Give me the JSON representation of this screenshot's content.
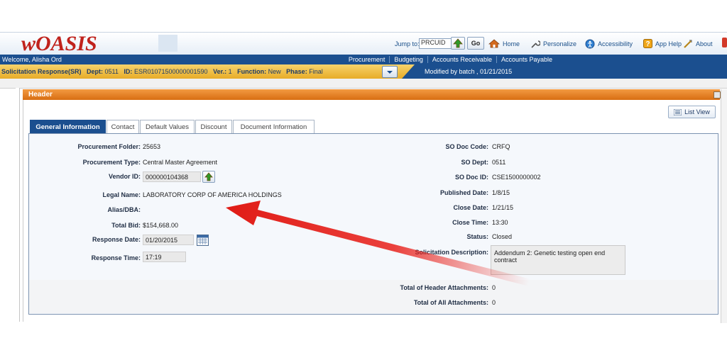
{
  "app": {
    "logo_text": "wOASIS",
    "jump_to_label": "Jump to:",
    "jump_to_value": "PRCUID",
    "go_label": "Go",
    "nav_links": [
      "Home",
      "Personalize",
      "Accessibility",
      "App Help",
      "About"
    ]
  },
  "menubar": {
    "welcome": "Welcome, Alisha Ord",
    "items": [
      "Procurement",
      "Budgeting",
      "Accounts Receivable",
      "Accounts Payable"
    ]
  },
  "docbar": {
    "doc_type": "Solicitation Response(SR)",
    "dept_label": "Dept:",
    "dept_value": "0511",
    "id_label": "ID:",
    "id_value": "ESR01071500000001590",
    "ver_label": "Ver.:",
    "ver_value": "1",
    "function_label": "Function:",
    "function_value": "New",
    "phase_label": "Phase:",
    "phase_value": "Final",
    "modified": "Modified by batch , 01/21/2015"
  },
  "panel": {
    "title": "Header",
    "list_view_label": "List View"
  },
  "tabs": [
    "General Information",
    "Contact",
    "Default Values",
    "Discount",
    "Document Information"
  ],
  "left_fields": {
    "procurement_folder_label": "Procurement Folder:",
    "procurement_folder_value": "25653",
    "procurement_type_label": "Procurement Type:",
    "procurement_type_value": "Central Master Agreement",
    "vendor_id_label": "Vendor ID:",
    "vendor_id_value": "000000104368",
    "legal_name_label": "Legal Name:",
    "legal_name_value": "LABORATORY CORP OF AMERICA HOLDINGS",
    "alias_label": "Alias/DBA:",
    "alias_value": "",
    "total_bid_label": "Total Bid:",
    "total_bid_value": "$154,668.00",
    "response_date_label": "Response Date:",
    "response_date_value": "01/20/2015",
    "response_time_label": "Response Time:",
    "response_time_value": "17:19"
  },
  "right_fields": {
    "so_doc_code_label": "SO Doc Code:",
    "so_doc_code_value": "CRFQ",
    "so_dept_label": "SO Dept:",
    "so_dept_value": "0511",
    "so_doc_id_label": "SO Doc ID:",
    "so_doc_id_value": "CSE1500000002",
    "published_date_label": "Published Date:",
    "published_date_value": "1/8/15",
    "close_date_label": "Close Date:",
    "close_date_value": "1/21/15",
    "close_time_label": "Close Time:",
    "close_time_value": "13:30",
    "status_label": "Status:",
    "status_value": "Closed",
    "solicitation_desc_label": "Solicitation Description:",
    "solicitation_desc_value": "Addendum 2: Genetic testing open end contract",
    "header_attachments_label": "Total of Header Attachments:",
    "header_attachments_value": "0",
    "all_attachments_label": "Total of All Attachments:",
    "all_attachments_value": "0"
  },
  "colors": {
    "menubar_blue": "#1b4f8f",
    "docbar_gold": "#e7ac28",
    "header_orange": "#e07a1e",
    "annotation_arrow_red": "#e8201a"
  },
  "icons": [
    "house-icon",
    "wrench-icon",
    "accessibility-icon",
    "help-icon",
    "about-icon",
    "calendar-icon",
    "lookup-arrow-icon",
    "list-view-icon"
  ]
}
